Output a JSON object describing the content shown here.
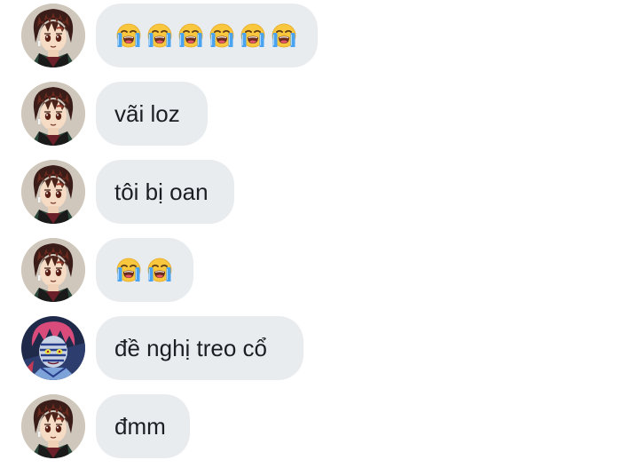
{
  "colors": {
    "bubble_bg": "#e9ecef",
    "text": "#1b1f23",
    "page_bg": "#ffffff"
  },
  "messages": [
    {
      "sender_avatar": "tanjiro-avatar",
      "emoji": "loudly-crying-face",
      "emoji_count": 6
    },
    {
      "sender_avatar": "tanjiro-avatar",
      "text": "vãi loz"
    },
    {
      "sender_avatar": "tanjiro-avatar",
      "text": "tôi bị oan"
    },
    {
      "sender_avatar": "tanjiro-avatar",
      "emoji": "loudly-crying-face",
      "emoji_count": 2
    },
    {
      "sender_avatar": "akaza-avatar",
      "text": "đề nghị treo cổ"
    },
    {
      "sender_avatar": "tanjiro-avatar",
      "text": "đmm"
    }
  ]
}
